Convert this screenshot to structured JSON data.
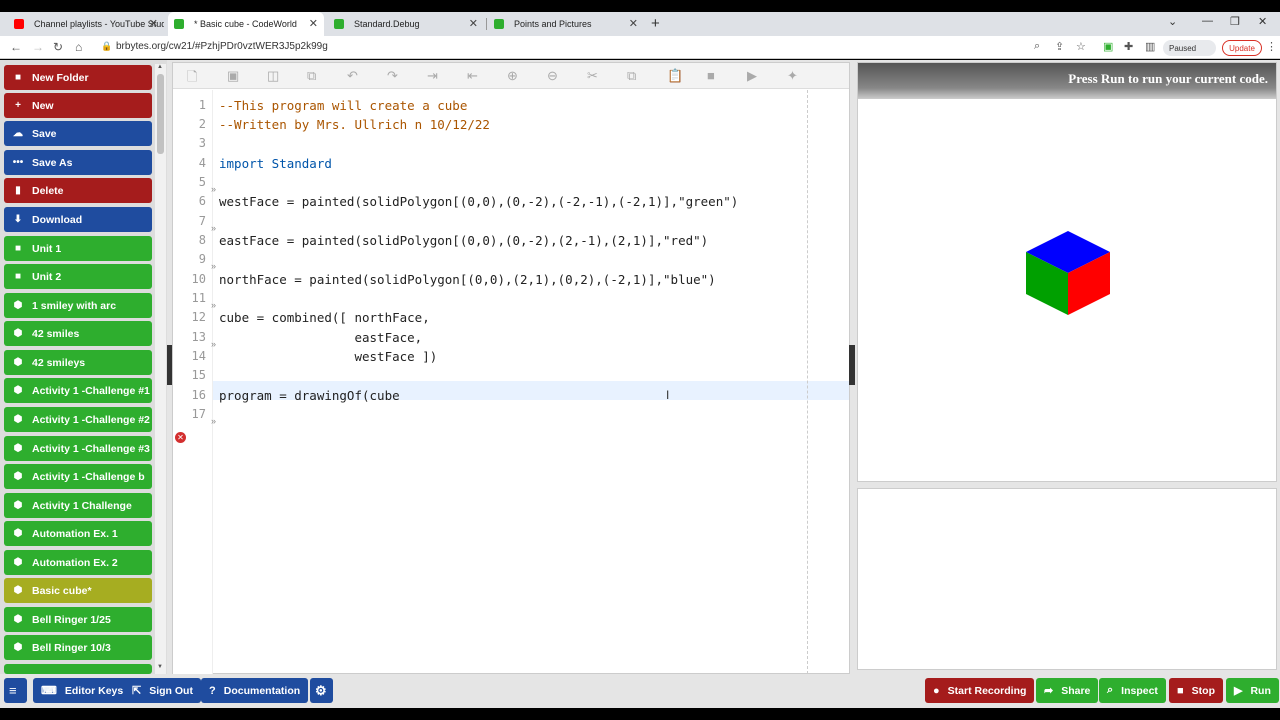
{
  "browser": {
    "tabs": [
      {
        "title": "Channel playlists - YouTube Studi",
        "color": "#ff0000"
      },
      {
        "title": "* Basic cube - CodeWorld",
        "color": "#2eae2e"
      },
      {
        "title": "Standard.Debug",
        "color": "#2eae2e"
      },
      {
        "title": "Points and Pictures",
        "color": "#2eae2e"
      }
    ],
    "url": "brbytes.org/cw21/#PzhjPDr0vztWER3J5p2k99g",
    "paused_label": "Paused",
    "update_label": "Update"
  },
  "sidebar": {
    "items": [
      {
        "label": "New Folder",
        "icon": "folder-icon",
        "style": "red"
      },
      {
        "label": "New",
        "icon": "plus-icon",
        "style": "red"
      },
      {
        "label": "Save",
        "icon": "cloud-upload-icon",
        "style": "blue"
      },
      {
        "label": "Save As",
        "icon": "more-icon",
        "style": "blue"
      },
      {
        "label": "Delete",
        "icon": "trash-icon",
        "style": "red"
      },
      {
        "label": "Download",
        "icon": "download-icon",
        "style": "blue"
      },
      {
        "label": "Unit 1",
        "icon": "folder-icon",
        "style": "green"
      },
      {
        "label": "Unit 2",
        "icon": "folder-icon",
        "style": "green"
      },
      {
        "label": "1 smiley with arc",
        "icon": "cube-icon",
        "style": "green"
      },
      {
        "label": "42 smiles",
        "icon": "cube-icon",
        "style": "green"
      },
      {
        "label": "42 smileys",
        "icon": "cube-icon",
        "style": "green"
      },
      {
        "label": "Activity 1 -Challenge #1",
        "icon": "cube-icon",
        "style": "green"
      },
      {
        "label": "Activity 1 -Challenge #2",
        "icon": "cube-icon",
        "style": "green"
      },
      {
        "label": "Activity 1 -Challenge #3",
        "icon": "cube-icon",
        "style": "green"
      },
      {
        "label": "Activity 1 -Challenge b",
        "icon": "cube-icon",
        "style": "green"
      },
      {
        "label": "Activity 1 Challenge",
        "icon": "cube-icon",
        "style": "green"
      },
      {
        "label": "Automation Ex. 1",
        "icon": "cube-icon",
        "style": "green"
      },
      {
        "label": "Automation Ex. 2",
        "icon": "cube-icon",
        "style": "green"
      },
      {
        "label": "Basic cube*",
        "icon": "cube-icon",
        "style": "olive"
      },
      {
        "label": "Bell Ringer 1/25",
        "icon": "cube-icon",
        "style": "green"
      },
      {
        "label": "Bell Ringer 10/3",
        "icon": "cube-icon",
        "style": "green"
      }
    ]
  },
  "editor": {
    "line_numbers": [
      "1",
      "2",
      "3",
      "4",
      "5",
      "6",
      "7",
      "8",
      "9",
      "10",
      "11",
      "12",
      "13",
      "14",
      "15",
      "16",
      "17"
    ],
    "lines": [
      "--This program will create a cube",
      "--Written by Mrs. Ullrich n 10/12/22",
      "",
      "import Standard",
      "",
      "westFace = painted(solidPolygon[(0,0),(0,-2),(-2,-1),(-2,1)],\"green\")",
      "",
      "eastFace = painted(solidPolygon[(0,0),(0,-2),(2,-1),(2,1)],\"red\")",
      "",
      "northFace = painted(solidPolygon[(0,0),(2,1),(0,2),(-2,1)],\"blue\")",
      "",
      "cube = combined([ northFace,",
      "                  eastFace,",
      "                  westFace ])",
      "",
      "program = drawingOf(cube",
      ""
    ]
  },
  "output": {
    "message": "Press Run to run your current code.",
    "cube_colors": {
      "top": "#0000ff",
      "left": "#00a000",
      "right": "#ff0000"
    }
  },
  "bottom": {
    "editor_keys": "Editor Keys",
    "sign_out": "Sign Out",
    "documentation": "Documentation",
    "start_recording": "Start Recording",
    "share": "Share",
    "inspect": "Inspect",
    "stop": "Stop",
    "run": "Run"
  }
}
